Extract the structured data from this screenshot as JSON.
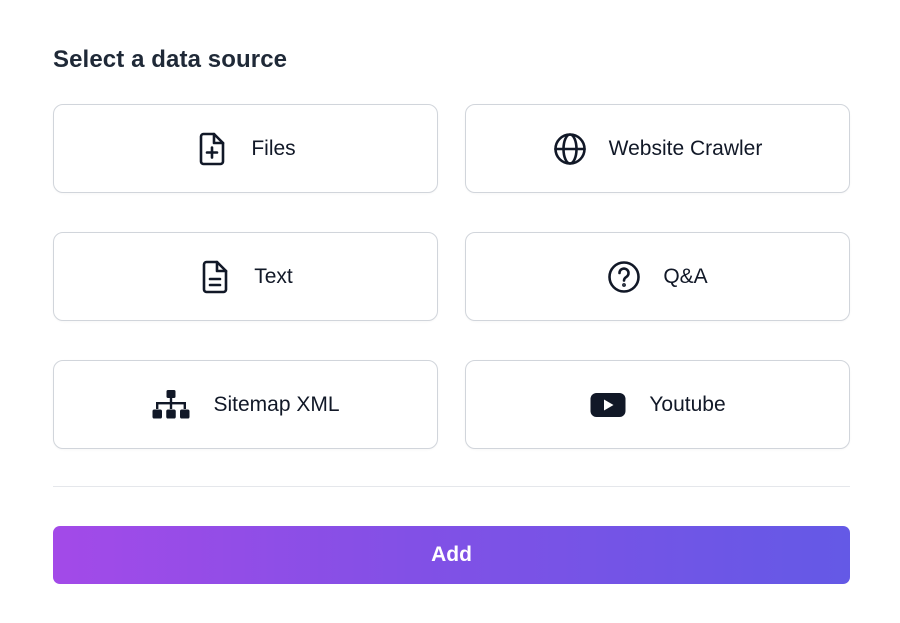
{
  "dialog": {
    "title": "Select a data source",
    "add_label": "Add"
  },
  "sources": [
    {
      "label": "Files",
      "icon": "file-plus-icon"
    },
    {
      "label": "Website Crawler",
      "icon": "globe-icon"
    },
    {
      "label": "Text",
      "icon": "document-text-icon"
    },
    {
      "label": "Q&A",
      "icon": "question-circle-icon"
    },
    {
      "label": "Sitemap XML",
      "icon": "sitemap-icon"
    },
    {
      "label": "Youtube",
      "icon": "youtube-icon"
    }
  ],
  "colors": {
    "text": "#111827",
    "border": "#d1d5db",
    "gradient_start": "#a34ae8",
    "gradient_end": "#6459e6"
  }
}
